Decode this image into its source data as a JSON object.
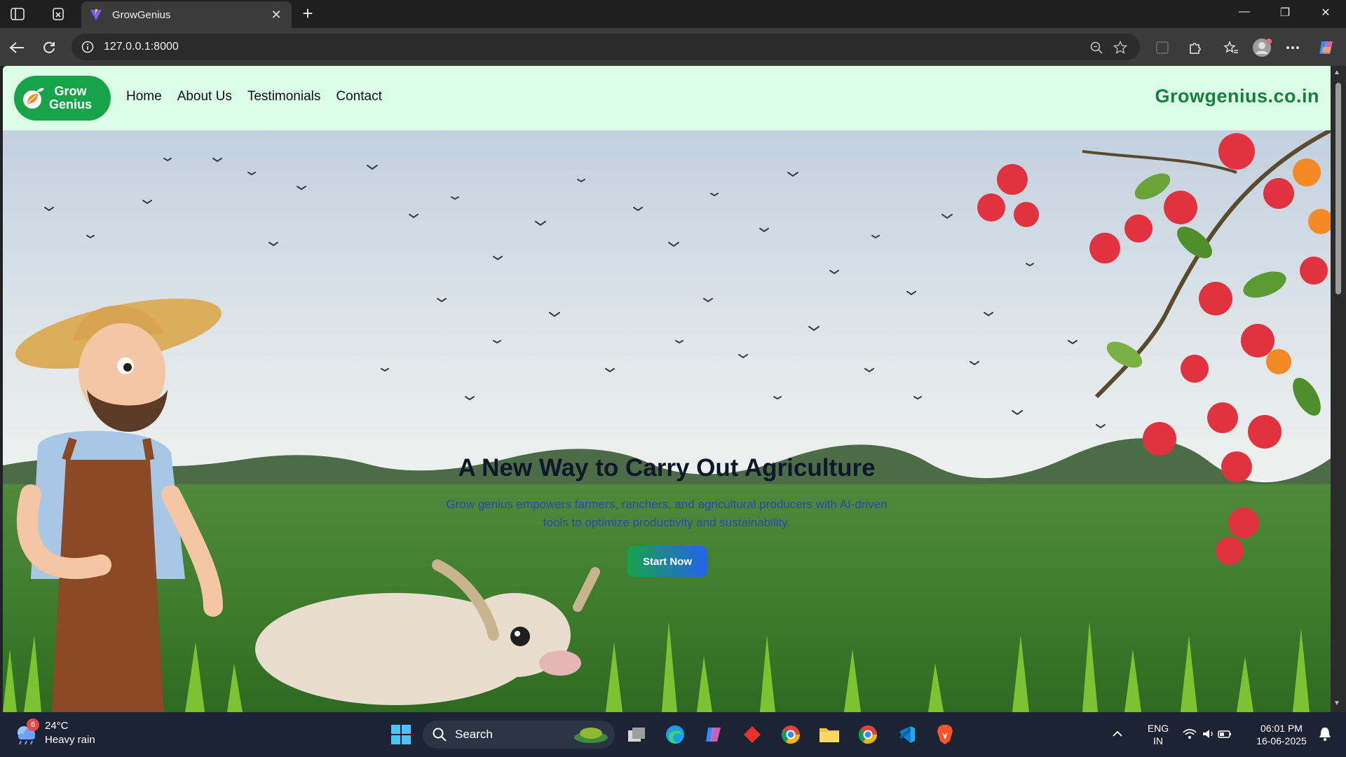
{
  "browser": {
    "tab_title": "GrowGenius",
    "url": "127.0.0.1:8000"
  },
  "header": {
    "logo_line1": "Grow",
    "logo_line2": "Genius",
    "nav": [
      "Home",
      "About Us",
      "Testimonials",
      "Contact"
    ],
    "brand": "Growgenius.co.in"
  },
  "hero": {
    "title": "A New Way to Carry Out Agriculture",
    "subtitle": "Grow genius empowers farmers, ranchers, and agricultural producers with AI-driven tools to optimize productivity and sustainability.",
    "cta": "Start Now"
  },
  "taskbar": {
    "weather_temp": "24°C",
    "weather_desc": "Heavy rain",
    "weather_badge": "6",
    "search_label": "Search",
    "lang_line1": "ENG",
    "lang_line2": "IN",
    "time": "06:01 PM",
    "date": "16-06-2025"
  },
  "colors": {
    "header_bg": "#dcfce7",
    "brand_green": "#15803d",
    "logo_green": "#16a34a",
    "subtitle_blue": "#2b45b8"
  }
}
